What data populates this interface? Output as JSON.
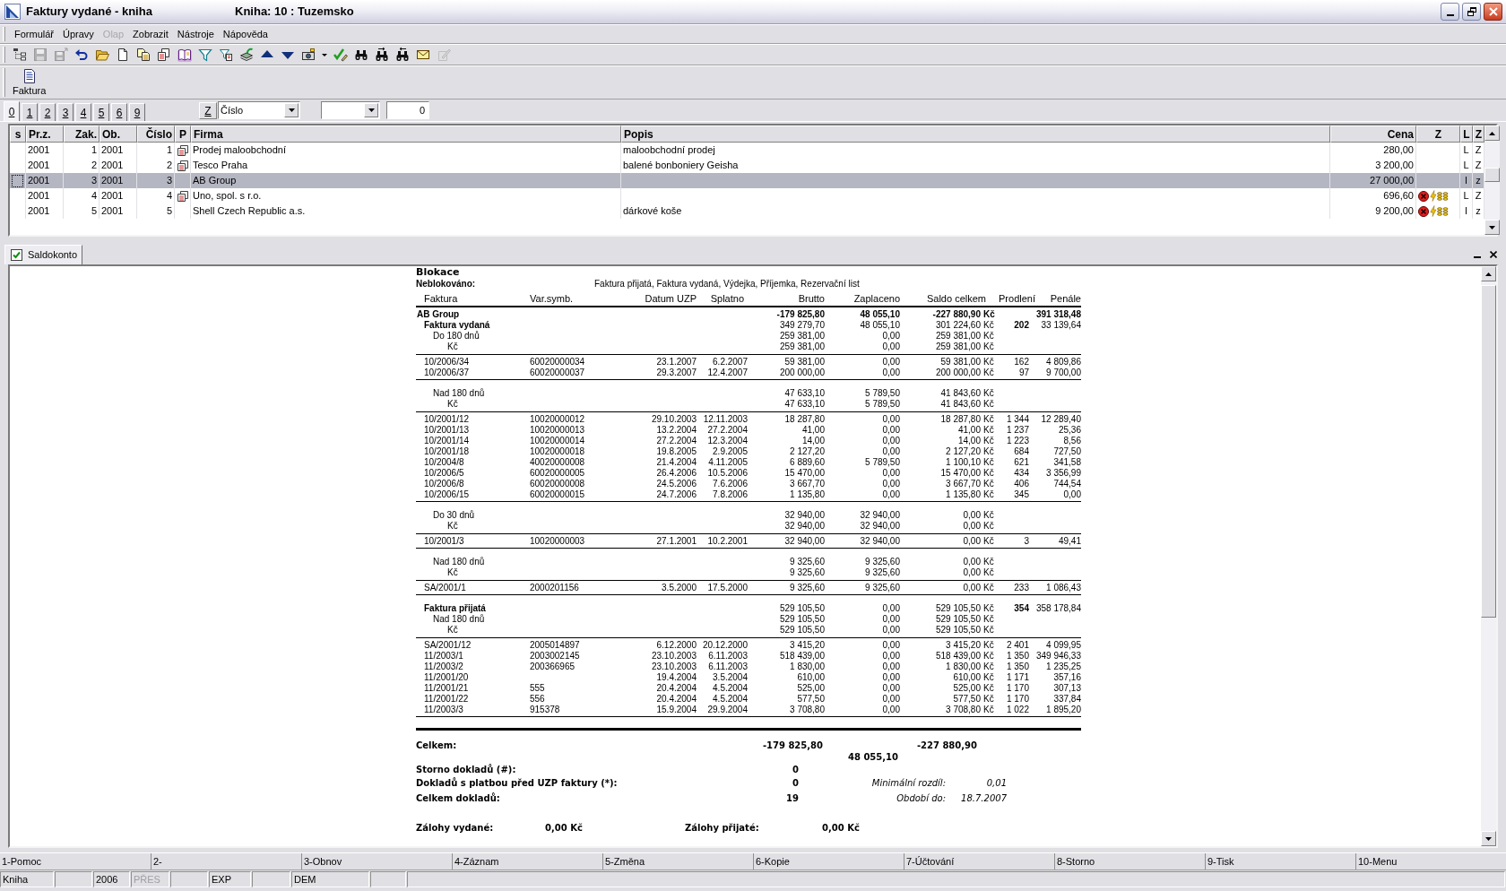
{
  "window": {
    "title": "Faktury vydané - kniha",
    "subtitle": "Kniha: 10 : Tuzemsko"
  },
  "menu": [
    {
      "label": "Formulář",
      "disabled": false
    },
    {
      "label": "Úpravy",
      "disabled": false
    },
    {
      "label": "Olap",
      "disabled": true
    },
    {
      "label": "Zobrazit",
      "disabled": false
    },
    {
      "label": "Nástroje",
      "disabled": false
    },
    {
      "label": "Nápověda",
      "disabled": false
    }
  ],
  "toolbar": [
    {
      "kind": "tree",
      "disabled": false
    },
    {
      "kind": "save",
      "disabled": true
    },
    {
      "kind": "save_as",
      "disabled": true
    },
    {
      "kind": "undo",
      "disabled": false
    },
    {
      "kind": "open",
      "disabled": false
    },
    {
      "kind": "new",
      "disabled": false
    },
    {
      "kind": "copy",
      "disabled": false
    },
    {
      "kind": "copy_red",
      "disabled": false
    },
    {
      "kind": "book",
      "disabled": false
    },
    {
      "kind": "filter",
      "disabled": false
    },
    {
      "kind": "filter_list",
      "disabled": false
    },
    {
      "kind": "stack",
      "disabled": false
    },
    {
      "kind": "up",
      "disabled": false
    },
    {
      "kind": "down",
      "disabled": false
    },
    {
      "kind": "camera",
      "disabled": false
    },
    {
      "kind": "dropdown",
      "disabled": false
    },
    {
      "kind": "check_edit",
      "disabled": false
    },
    {
      "kind": "find",
      "disabled": false
    },
    {
      "kind": "find_next",
      "disabled": false
    },
    {
      "kind": "find_prev",
      "disabled": false
    },
    {
      "kind": "mail",
      "disabled": false
    },
    {
      "kind": "edit",
      "disabled": true
    }
  ],
  "actions": [
    {
      "label": "Faktura"
    }
  ],
  "view_tabs": [
    {
      "label": "0",
      "selected": true
    },
    {
      "label": "1",
      "selected": false
    },
    {
      "label": "2",
      "selected": false
    },
    {
      "label": "3",
      "selected": false
    },
    {
      "label": "4",
      "selected": false
    },
    {
      "label": "5",
      "selected": false
    },
    {
      "label": "6",
      "selected": false
    },
    {
      "label": "9",
      "selected": false
    }
  ],
  "sort": {
    "button": "Z",
    "field": "Číslo",
    "value": "0"
  },
  "table": {
    "columns": [
      "s",
      "Pr.z.",
      "Zak.",
      "Ob.",
      "Číslo",
      "P",
      "Firma",
      "Popis",
      "Cena",
      "Z",
      "L",
      "Z"
    ],
    "rows": [
      {
        "selected": false,
        "pr_z": "2001",
        "zak": "1",
        "ob": "2001",
        "cislo": "1",
        "attachment": true,
        "firma": "Prodej maloobchodní",
        "popis": "maloobchodní prodej",
        "cena": "280,00",
        "alerts": false,
        "l": "L",
        "z": "Z"
      },
      {
        "selected": false,
        "pr_z": "2001",
        "zak": "2",
        "ob": "2001",
        "cislo": "2",
        "attachment": true,
        "firma": "Tesco Praha",
        "popis": "balené bonboniery Geisha",
        "cena": "3 200,00",
        "alerts": false,
        "l": "L",
        "z": "Z"
      },
      {
        "selected": true,
        "pr_z": "2001",
        "zak": "3",
        "ob": "2001",
        "cislo": "3",
        "attachment": false,
        "firma": "AB Group",
        "cena": "27 000,00",
        "alerts": false,
        "l": "l",
        "z": "z"
      },
      {
        "selected": false,
        "pr_z": "2001",
        "zak": "4",
        "ob": "2001",
        "cislo": "4",
        "attachment": true,
        "firma": "Uno, spol. s r.o.",
        "cena": "696,60",
        "alerts": true,
        "l": "L",
        "z": "Z"
      },
      {
        "selected": false,
        "pr_z": "2001",
        "zak": "5",
        "ob": "2001",
        "cislo": "5",
        "attachment": false,
        "firma": "Shell Czech Republic a.s.",
        "popis": "dárkové koše",
        "cena": "9 200,00",
        "alerts": true,
        "l": "l",
        "z": "z"
      }
    ]
  },
  "panel_tab": {
    "label": "Saldokonto",
    "checked": true
  },
  "report": {
    "title": "Blokace",
    "unblocked_label": "Neblokováno:",
    "unblocked_value": "Faktura přijatá, Faktura vydaná, Výdejka, Příjemka, Rezervační list",
    "columns": [
      "Faktura",
      "Var.symb.",
      "Datum UZP",
      "Splatno",
      "Brutto",
      "Zaplaceno",
      "Saldo celkem",
      "Prodlení",
      "Penále"
    ],
    "items": [
      {
        "kind": "company",
        "label": "AB Group",
        "brutto": "-179 825,80",
        "zaplaceno": "48 055,10",
        "saldo": "-227 880,90",
        "mena": "Kč",
        "penale": "391 318,48"
      },
      {
        "kind": "doc_type",
        "label": "Faktura vydaná",
        "brutto": "349 279,70",
        "zaplaceno": "48 055,10",
        "saldo": "301 224,60",
        "mena": "Kč",
        "prodleni": "202",
        "penale": "33 139,64"
      },
      {
        "kind": "group",
        "label": "Do 180 dnů",
        "brutto": "259 381,00",
        "zaplaceno": "0,00",
        "saldo": "259 381,00",
        "mena": "Kč"
      },
      {
        "kind": "currency",
        "label": "Kč",
        "brutto": "259 381,00",
        "zaplaceno": "0,00",
        "saldo": "259 381,00",
        "mena": "Kč"
      },
      {
        "kind": "invoice",
        "label": "10/2006/34",
        "var_symb": "60020000034",
        "datum_uzp": "23.1.2007",
        "splatno": "6.2.2007",
        "brutto": "59 381,00",
        "zaplaceno": "0,00",
        "saldo": "59 381,00",
        "mena": "Kč",
        "prodleni": "162",
        "penale": "4 809,86"
      },
      {
        "kind": "invoice",
        "label": "10/2006/37",
        "var_symb": "60020000037",
        "datum_uzp": "29.3.2007",
        "splatno": "12.4.2007",
        "brutto": "200 000,00",
        "zaplaceno": "0,00",
        "saldo": "200 000,00",
        "mena": "Kč",
        "prodleni": "97",
        "penale": "9 700,00"
      },
      {
        "kind": "group",
        "label": "Nad 180 dnů",
        "brutto": "47 633,10",
        "zaplaceno": "5 789,50",
        "saldo": "41 843,60",
        "mena": "Kč"
      },
      {
        "kind": "currency",
        "label": "Kč",
        "brutto": "47 633,10",
        "zaplaceno": "5 789,50",
        "saldo": "41 843,60",
        "mena": "Kč"
      },
      {
        "kind": "invoice",
        "label": "10/2001/12",
        "var_symb": "10020000012",
        "datum_uzp": "29.10.2003",
        "splatno": "12.11.2003",
        "brutto": "18 287,80",
        "zaplaceno": "0,00",
        "saldo": "18 287,80",
        "mena": "Kč",
        "prodleni": "1 344",
        "penale": "12 289,40"
      },
      {
        "kind": "invoice",
        "label": "10/2001/13",
        "var_symb": "10020000013",
        "datum_uzp": "13.2.2004",
        "splatno": "27.2.2004",
        "brutto": "41,00",
        "zaplaceno": "0,00",
        "saldo": "41,00",
        "mena": "Kč",
        "prodleni": "1 237",
        "penale": "25,36"
      },
      {
        "kind": "invoice",
        "label": "10/2001/14",
        "var_symb": "10020000014",
        "datum_uzp": "27.2.2004",
        "splatno": "12.3.2004",
        "brutto": "14,00",
        "zaplaceno": "0,00",
        "saldo": "14,00",
        "mena": "Kč",
        "prodleni": "1 223",
        "penale": "8,56"
      },
      {
        "kind": "invoice",
        "label": "10/2001/18",
        "var_symb": "10020000018",
        "datum_uzp": "19.8.2005",
        "splatno": "2.9.2005",
        "brutto": "2 127,20",
        "zaplaceno": "0,00",
        "saldo": "2 127,20",
        "mena": "Kč",
        "prodleni": "684",
        "penale": "727,50"
      },
      {
        "kind": "invoice",
        "label": "10/2004/8",
        "var_symb": "40020000008",
        "datum_uzp": "21.4.2004",
        "splatno": "4.11.2005",
        "brutto": "6 889,60",
        "zaplaceno": "5 789,50",
        "saldo": "1 100,10",
        "mena": "Kč",
        "prodleni": "621",
        "penale": "341,58"
      },
      {
        "kind": "invoice",
        "label": "10/2006/5",
        "var_symb": "60020000005",
        "datum_uzp": "26.4.2006",
        "splatno": "10.5.2006",
        "brutto": "15 470,00",
        "zaplaceno": "0,00",
        "saldo": "15 470,00",
        "mena": "Kč",
        "prodleni": "434",
        "penale": "3 356,99"
      },
      {
        "kind": "invoice",
        "label": "10/2006/8",
        "var_symb": "60020000008",
        "datum_uzp": "24.5.2006",
        "splatno": "7.6.2006",
        "brutto": "3 667,70",
        "zaplaceno": "0,00",
        "saldo": "3 667,70",
        "mena": "Kč",
        "prodleni": "406",
        "penale": "744,54"
      },
      {
        "kind": "invoice",
        "label": "10/2006/15",
        "var_symb": "60020000015",
        "datum_uzp": "24.7.2006",
        "splatno": "7.8.2006",
        "brutto": "1 135,80",
        "zaplaceno": "0,00",
        "saldo": "1 135,80",
        "mena": "Kč",
        "prodleni": "345",
        "penale": "0,00"
      },
      {
        "kind": "group",
        "label": "Do 30 dnů",
        "brutto": "32 940,00",
        "zaplaceno": "32 940,00",
        "saldo": "0,00",
        "mena": "Kč"
      },
      {
        "kind": "currency",
        "label": "Kč",
        "brutto": "32 940,00",
        "zaplaceno": "32 940,00",
        "saldo": "0,00",
        "mena": "Kč"
      },
      {
        "kind": "invoice",
        "label": "10/2001/3",
        "var_symb": "10020000003",
        "datum_uzp": "27.1.2001",
        "splatno": "10.2.2001",
        "brutto": "32 940,00",
        "zaplaceno": "32 940,00",
        "saldo": "0,00",
        "mena": "Kč",
        "prodleni": "3",
        "penale": "49,41"
      },
      {
        "kind": "group",
        "label": "Nad 180 dnů",
        "brutto": "9 325,60",
        "zaplaceno": "9 325,60",
        "saldo": "0,00",
        "mena": "Kč"
      },
      {
        "kind": "currency",
        "label": "Kč",
        "brutto": "9 325,60",
        "zaplaceno": "9 325,60",
        "saldo": "0,00",
        "mena": "Kč"
      },
      {
        "kind": "invoice",
        "label": "SA/2001/1",
        "var_symb": "2000201156",
        "datum_uzp": "3.5.2000",
        "splatno": "17.5.2000",
        "brutto": "9 325,60",
        "zaplaceno": "9 325,60",
        "saldo": "0,00",
        "mena": "Kč",
        "prodleni": "233",
        "penale": "1 086,43"
      },
      {
        "kind": "doc_type",
        "label": "Faktura přijatá",
        "brutto": "529 105,50",
        "zaplaceno": "0,00",
        "saldo": "529 105,50",
        "mena": "Kč",
        "prodleni": "354",
        "penale": "358 178,84"
      },
      {
        "kind": "group",
        "label": "Nad 180 dnů",
        "brutto": "529 105,50",
        "zaplaceno": "0,00",
        "saldo": "529 105,50",
        "mena": "Kč"
      },
      {
        "kind": "currency",
        "label": "Kč",
        "brutto": "529 105,50",
        "zaplaceno": "0,00",
        "saldo": "529 105,50",
        "mena": "Kč"
      },
      {
        "kind": "invoice",
        "label": "SA/2001/12",
        "var_symb": "2005014897",
        "datum_uzp": "6.12.2000",
        "splatno": "20.12.2000",
        "brutto": "3 415,20",
        "zaplaceno": "0,00",
        "saldo": "3 415,20",
        "mena": "Kč",
        "prodleni": "2 401",
        "penale": "4 099,95"
      },
      {
        "kind": "invoice",
        "label": "11/2003/1",
        "var_symb": "2003002145",
        "datum_uzp": "23.10.2003",
        "splatno": "6.11.2003",
        "brutto": "518 439,00",
        "zaplaceno": "0,00",
        "saldo": "518 439,00",
        "mena": "Kč",
        "prodleni": "1 350",
        "penale": "349 946,33"
      },
      {
        "kind": "invoice",
        "label": "11/2003/2",
        "var_symb": "200366965",
        "datum_uzp": "23.10.2003",
        "splatno": "6.11.2003",
        "brutto": "1 830,00",
        "zaplaceno": "0,00",
        "saldo": "1 830,00",
        "mena": "Kč",
        "prodleni": "1 350",
        "penale": "1 235,25"
      },
      {
        "kind": "invoice",
        "label": "11/2001/20",
        "datum_uzp": "19.4.2004",
        "splatno": "3.5.2004",
        "brutto": "610,00",
        "zaplaceno": "0,00",
        "saldo": "610,00",
        "mena": "Kč",
        "prodleni": "1 171",
        "penale": "357,16"
      },
      {
        "kind": "invoice",
        "label": "11/2001/21",
        "var_symb": "555",
        "datum_uzp": "20.4.2004",
        "splatno": "4.5.2004",
        "brutto": "525,00",
        "zaplaceno": "0,00",
        "saldo": "525,00",
        "mena": "Kč",
        "prodleni": "1 170",
        "penale": "307,13"
      },
      {
        "kind": "invoice",
        "label": "11/2001/22",
        "var_symb": "556",
        "datum_uzp": "20.4.2004",
        "splatno": "4.5.2004",
        "brutto": "577,50",
        "zaplaceno": "0,00",
        "saldo": "577,50",
        "mena": "Kč",
        "prodleni": "1 170",
        "penale": "337,84"
      },
      {
        "kind": "invoice",
        "label": "11/2003/3",
        "var_symb": "915378",
        "datum_uzp": "15.9.2004",
        "splatno": "29.9.2004",
        "brutto": "3 708,80",
        "zaplaceno": "0,00",
        "saldo": "3 708,80",
        "mena": "Kč",
        "prodleni": "1 022",
        "penale": "1 895,20"
      }
    ],
    "summary": {
      "total_label": "Celkem:",
      "total_brutto": "-179 825,80",
      "total_zaplaceno": "48 055,10",
      "total_saldo": "-227 880,90",
      "counts": [
        {
          "label": "Storno dokladů (#):",
          "value": "0"
        },
        {
          "label": "Dokladů s platbou před UZP faktury (*):",
          "value": "0",
          "note_label": "Minimální rozdíl:",
          "note_value": "0,01"
        },
        {
          "label": "Celkem dokladů:",
          "value": "19",
          "note_label": "Období do:",
          "note_value": "18.7.2007"
        }
      ],
      "advances": [
        {
          "label": "Zálohy vydané:",
          "value": "0,00 Kč"
        },
        {
          "label": "Zálohy přijaté:",
          "value": "0,00 Kč"
        }
      ]
    }
  },
  "function_keys": [
    "1-Pomoc",
    "2-",
    "3-Obnov",
    "4-Záznam",
    "5-Změna",
    "6-Kopie",
    "7-Účtování",
    "8-Storno",
    "9-Tisk",
    "10-Menu"
  ],
  "status_bar": [
    {
      "text": "Kniha",
      "disabled": false
    },
    {
      "text": "2006",
      "disabled": false
    },
    {
      "text": "PŘES",
      "disabled": true
    },
    {
      "text": "EXP",
      "disabled": false
    },
    {
      "text": "DEM",
      "disabled": false
    }
  ]
}
